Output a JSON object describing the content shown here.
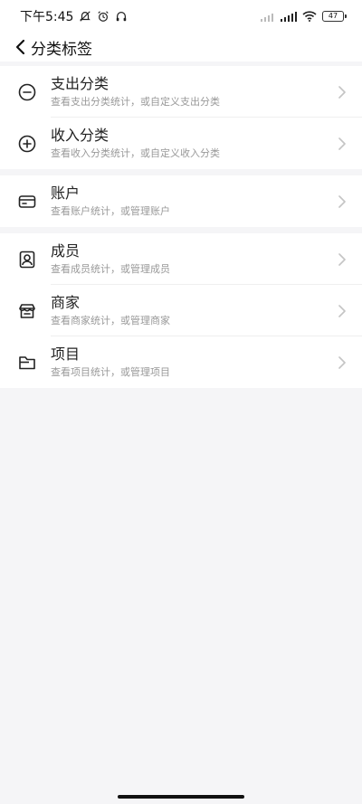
{
  "status_bar": {
    "time": "下午5:45",
    "battery": "47"
  },
  "nav": {
    "title": "分类标签"
  },
  "groups": [
    {
      "items": [
        {
          "title": "支出分类",
          "subtitle": "查看支出分类统计，或自定义支出分类",
          "icon": "minus-circle-icon"
        },
        {
          "title": "收入分类",
          "subtitle": "查看收入分类统计，或自定义收入分类",
          "icon": "plus-circle-icon"
        }
      ]
    },
    {
      "items": [
        {
          "title": "账户",
          "subtitle": "查看账户统计，或管理账户",
          "icon": "card-icon"
        }
      ]
    },
    {
      "items": [
        {
          "title": "成员",
          "subtitle": "查看成员统计，或管理成员",
          "icon": "person-icon"
        },
        {
          "title": "商家",
          "subtitle": "查看商家统计，或管理商家",
          "icon": "store-icon"
        },
        {
          "title": "项目",
          "subtitle": "查看项目统计，或管理项目",
          "icon": "folder-icon"
        }
      ]
    }
  ],
  "colors": {
    "background": "#f5f5f7",
    "card": "#ffffff",
    "subtitle": "#999999",
    "chevron": "#c4c4c4"
  }
}
